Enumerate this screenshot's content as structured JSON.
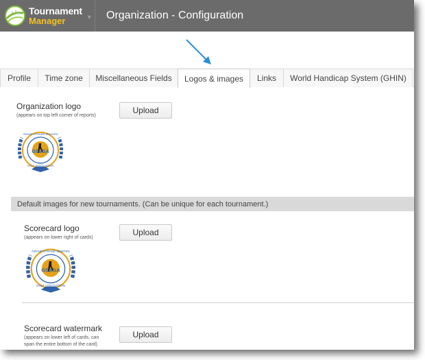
{
  "header": {
    "logo_line1": "Tournament",
    "logo_line2": "Manager",
    "title": "Organization - Configuration"
  },
  "tabs": [
    {
      "label": "Profile",
      "active": false
    },
    {
      "label": "Time zone",
      "active": false
    },
    {
      "label": "Miscellaneous Fields",
      "active": false
    },
    {
      "label": "Logos & images",
      "active": true
    },
    {
      "label": "Links",
      "active": false
    },
    {
      "label": "World Handicap System (GHIN)",
      "active": false
    }
  ],
  "org_logo": {
    "label": "Organization logo",
    "sublabel": "(appears on top left corner of reports)",
    "button": "Upload"
  },
  "defaults_band": "Default images for new tournaments. (Can be unique for each tournament.)",
  "scorecard_logo": {
    "label": "Scorecard logo",
    "sublabel": "(appears on lower right of cards)",
    "button": "Upload"
  },
  "scorecard_watermark": {
    "label": "Scorecard watermark",
    "sublabel_line1": "(appears on lower left of cards, can",
    "sublabel_line2": "span the entire bottom of the card)",
    "button": "Upload"
  },
  "seal": {
    "ring_text_top": "GRAND STRAND SENIORS",
    "ring_text_bottom": "GOLF ASSOCIATION",
    "center_text": "GSSGA"
  },
  "colors": {
    "header_bg": "#6b6b6b",
    "logo_accent": "#f3c021",
    "arrow": "#2a8fd6",
    "seal_blue": "#2f62a8",
    "seal_gold": "#e3a21a"
  }
}
